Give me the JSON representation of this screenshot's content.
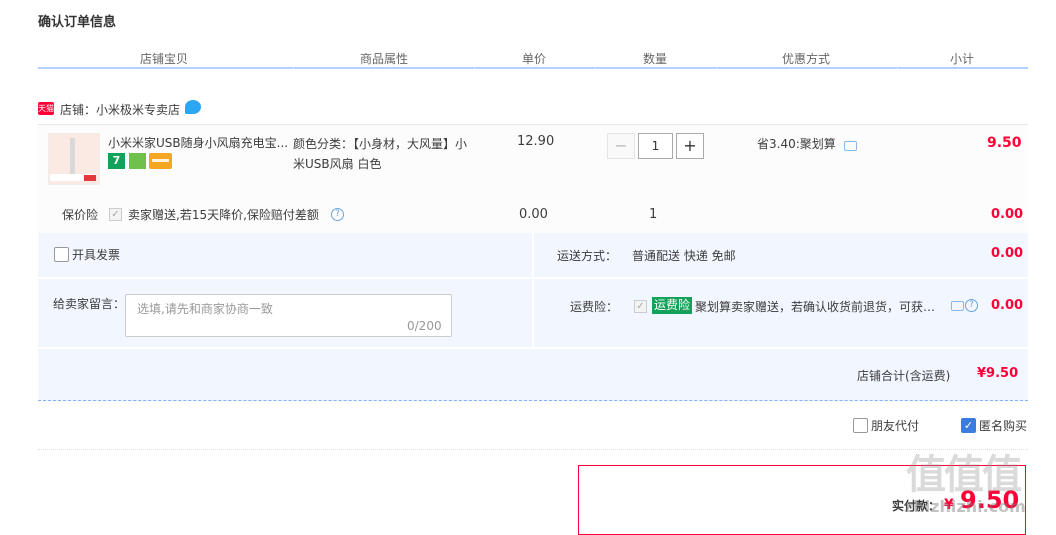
{
  "page_title": "确认订单信息",
  "columns": [
    "店铺宝贝",
    "商品属性",
    "单价",
    "数量",
    "优惠方式",
    "小计"
  ],
  "shop": {
    "badge": "天猫",
    "name": "店铺：小米极米专卖店"
  },
  "item": {
    "title": "小米米家USB随身小风扇充电宝...",
    "badge7": "7",
    "attributes": "颜色分类：【小身材，大风量】小米USB风扇 白色",
    "unit_price": "12.90",
    "quantity": "1",
    "qty_minus": "−",
    "qty_plus": "+",
    "promotion": "省3.40:聚划算",
    "subtotal": "9.50"
  },
  "insurance": {
    "label": "保价险",
    "desc": "卖家赠送,若15天降价,保险赔付差额",
    "price": "0.00",
    "qty": "1",
    "subtotal": "0.00"
  },
  "invoice": {
    "label": "开具发票"
  },
  "shipping": {
    "label": "运送方式：",
    "value": "普通配送 快递 免邮",
    "price": "0.00"
  },
  "message": {
    "label": "给卖家留言：",
    "placeholder": "选填,请先和商家协商一致",
    "count": "0/200"
  },
  "freight_insurance": {
    "label": "运费险：",
    "badge": "运费险",
    "desc": "聚划算卖家赠送，若确认收货前退货，可获保...",
    "price": "0.00"
  },
  "shop_total": {
    "label": "店铺合计(含运费)",
    "value": "¥9.50"
  },
  "options": {
    "friend_pay": "朋友代付",
    "anonymous": "匿名购买"
  },
  "payment": {
    "label": "实付款：",
    "currency": "¥",
    "amount": "9.50"
  },
  "watermark": {
    "text": "值值值",
    "url": "zhizhizhi.com"
  },
  "colors": {
    "accent": "#ff0036",
    "header_line": "#b2d1ff",
    "panel": "#f2f7ff",
    "green_badge": "#12a25a"
  }
}
